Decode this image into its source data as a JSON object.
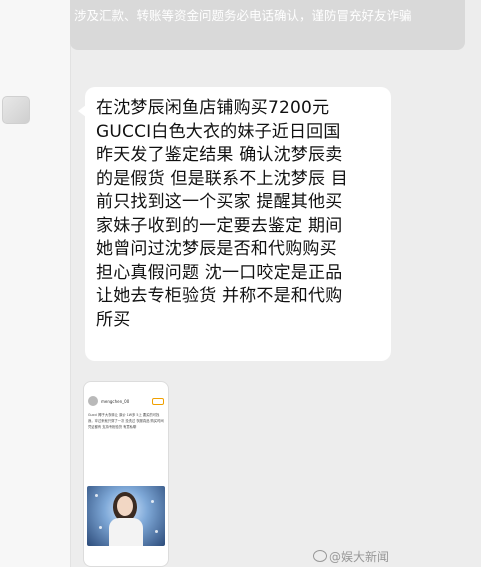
{
  "notice": {
    "text": "涉及汇款、转账等资金问题务必电话确认，谨防冒充好友诈骗"
  },
  "message": {
    "lines": [
      "在沈梦辰闲鱼店铺购买7200元",
      "GUCCI白色大衣的妹子近日回国",
      "昨天发了鉴定结果 确认沈梦辰卖",
      "的是假货 但是联系不上沈梦辰 目",
      "前只找到这一个买家 提醒其他买",
      "家妹子收到的一定要去鉴定 期间",
      "她曾问过沈梦辰是否和代购购买",
      "担心真假问题 沈一口咬定是正品",
      "让她去专柜验货 并称不是和代购",
      "所买"
    ]
  },
  "image_message": {
    "username": "mengchen_00",
    "post_text": "Gucci 椰子大衣转让 原价 1W多 5上 要买的可找我，拿过来就只穿了一次 没洗过 衣服真品 购买时间 凭证都有 支持专柜验货 有意私聊"
  },
  "watermark": {
    "text": "@娱大新闻"
  }
}
